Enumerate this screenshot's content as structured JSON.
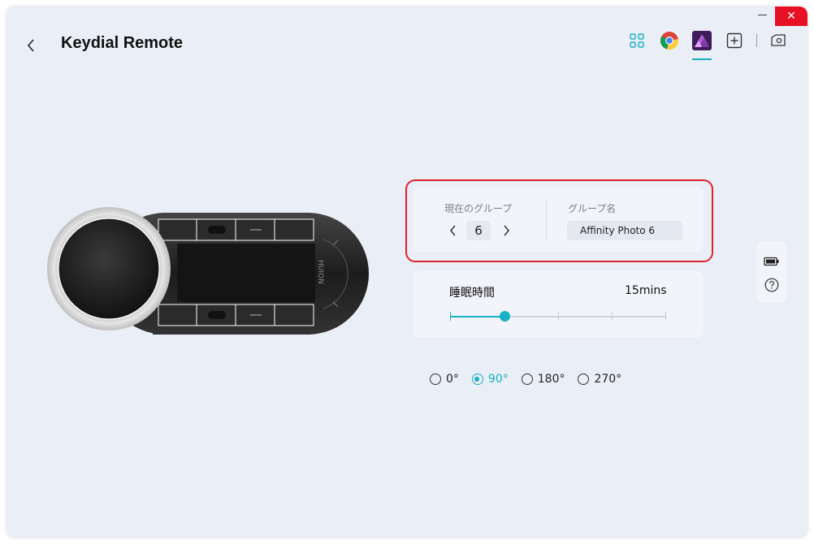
{
  "app": {
    "title": "Keydial Remote",
    "accent_color": "#18b0c4",
    "close_glyph": "✕"
  },
  "header": {
    "app_icons": [
      {
        "name": "grid-icon"
      },
      {
        "name": "chrome-icon"
      },
      {
        "name": "affinity-photo-icon",
        "active": true
      },
      {
        "name": "add-app-icon"
      },
      {
        "name": "device-settings-icon"
      }
    ]
  },
  "device": {
    "brand": "HUION"
  },
  "group": {
    "current_label": "現在のグループ",
    "current_value": "6",
    "name_label": "グループ名",
    "name_value": "Affinity Photo 6"
  },
  "sleep": {
    "label": "睡眠時間",
    "value": "15mins",
    "slider_fraction": 0.25
  },
  "rotation": {
    "options": [
      "0°",
      "90°",
      "180°",
      "270°"
    ],
    "selected": "90°"
  },
  "side": {
    "battery_icon": "battery-icon",
    "help_icon": "help-icon"
  }
}
